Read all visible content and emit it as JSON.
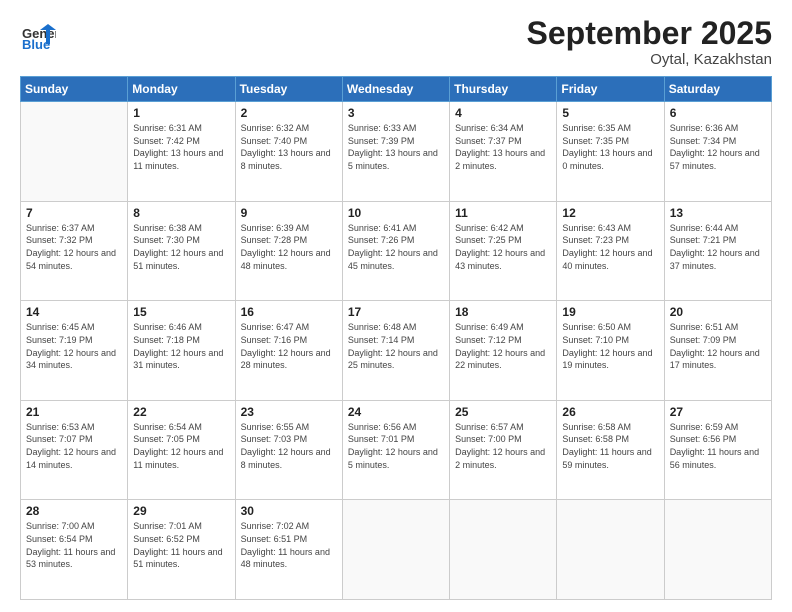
{
  "logo": {
    "text_general": "General",
    "text_blue": "Blue"
  },
  "title": "September 2025",
  "subtitle": "Oytal, Kazakhstan",
  "headers": [
    "Sunday",
    "Monday",
    "Tuesday",
    "Wednesday",
    "Thursday",
    "Friday",
    "Saturday"
  ],
  "weeks": [
    [
      {
        "day": "",
        "sunrise": "",
        "sunset": "",
        "daylight": ""
      },
      {
        "day": "1",
        "sunrise": "Sunrise: 6:31 AM",
        "sunset": "Sunset: 7:42 PM",
        "daylight": "Daylight: 13 hours and 11 minutes."
      },
      {
        "day": "2",
        "sunrise": "Sunrise: 6:32 AM",
        "sunset": "Sunset: 7:40 PM",
        "daylight": "Daylight: 13 hours and 8 minutes."
      },
      {
        "day": "3",
        "sunrise": "Sunrise: 6:33 AM",
        "sunset": "Sunset: 7:39 PM",
        "daylight": "Daylight: 13 hours and 5 minutes."
      },
      {
        "day": "4",
        "sunrise": "Sunrise: 6:34 AM",
        "sunset": "Sunset: 7:37 PM",
        "daylight": "Daylight: 13 hours and 2 minutes."
      },
      {
        "day": "5",
        "sunrise": "Sunrise: 6:35 AM",
        "sunset": "Sunset: 7:35 PM",
        "daylight": "Daylight: 13 hours and 0 minutes."
      },
      {
        "day": "6",
        "sunrise": "Sunrise: 6:36 AM",
        "sunset": "Sunset: 7:34 PM",
        "daylight": "Daylight: 12 hours and 57 minutes."
      }
    ],
    [
      {
        "day": "7",
        "sunrise": "Sunrise: 6:37 AM",
        "sunset": "Sunset: 7:32 PM",
        "daylight": "Daylight: 12 hours and 54 minutes."
      },
      {
        "day": "8",
        "sunrise": "Sunrise: 6:38 AM",
        "sunset": "Sunset: 7:30 PM",
        "daylight": "Daylight: 12 hours and 51 minutes."
      },
      {
        "day": "9",
        "sunrise": "Sunrise: 6:39 AM",
        "sunset": "Sunset: 7:28 PM",
        "daylight": "Daylight: 12 hours and 48 minutes."
      },
      {
        "day": "10",
        "sunrise": "Sunrise: 6:41 AM",
        "sunset": "Sunset: 7:26 PM",
        "daylight": "Daylight: 12 hours and 45 minutes."
      },
      {
        "day": "11",
        "sunrise": "Sunrise: 6:42 AM",
        "sunset": "Sunset: 7:25 PM",
        "daylight": "Daylight: 12 hours and 43 minutes."
      },
      {
        "day": "12",
        "sunrise": "Sunrise: 6:43 AM",
        "sunset": "Sunset: 7:23 PM",
        "daylight": "Daylight: 12 hours and 40 minutes."
      },
      {
        "day": "13",
        "sunrise": "Sunrise: 6:44 AM",
        "sunset": "Sunset: 7:21 PM",
        "daylight": "Daylight: 12 hours and 37 minutes."
      }
    ],
    [
      {
        "day": "14",
        "sunrise": "Sunrise: 6:45 AM",
        "sunset": "Sunset: 7:19 PM",
        "daylight": "Daylight: 12 hours and 34 minutes."
      },
      {
        "day": "15",
        "sunrise": "Sunrise: 6:46 AM",
        "sunset": "Sunset: 7:18 PM",
        "daylight": "Daylight: 12 hours and 31 minutes."
      },
      {
        "day": "16",
        "sunrise": "Sunrise: 6:47 AM",
        "sunset": "Sunset: 7:16 PM",
        "daylight": "Daylight: 12 hours and 28 minutes."
      },
      {
        "day": "17",
        "sunrise": "Sunrise: 6:48 AM",
        "sunset": "Sunset: 7:14 PM",
        "daylight": "Daylight: 12 hours and 25 minutes."
      },
      {
        "day": "18",
        "sunrise": "Sunrise: 6:49 AM",
        "sunset": "Sunset: 7:12 PM",
        "daylight": "Daylight: 12 hours and 22 minutes."
      },
      {
        "day": "19",
        "sunrise": "Sunrise: 6:50 AM",
        "sunset": "Sunset: 7:10 PM",
        "daylight": "Daylight: 12 hours and 19 minutes."
      },
      {
        "day": "20",
        "sunrise": "Sunrise: 6:51 AM",
        "sunset": "Sunset: 7:09 PM",
        "daylight": "Daylight: 12 hours and 17 minutes."
      }
    ],
    [
      {
        "day": "21",
        "sunrise": "Sunrise: 6:53 AM",
        "sunset": "Sunset: 7:07 PM",
        "daylight": "Daylight: 12 hours and 14 minutes."
      },
      {
        "day": "22",
        "sunrise": "Sunrise: 6:54 AM",
        "sunset": "Sunset: 7:05 PM",
        "daylight": "Daylight: 12 hours and 11 minutes."
      },
      {
        "day": "23",
        "sunrise": "Sunrise: 6:55 AM",
        "sunset": "Sunset: 7:03 PM",
        "daylight": "Daylight: 12 hours and 8 minutes."
      },
      {
        "day": "24",
        "sunrise": "Sunrise: 6:56 AM",
        "sunset": "Sunset: 7:01 PM",
        "daylight": "Daylight: 12 hours and 5 minutes."
      },
      {
        "day": "25",
        "sunrise": "Sunrise: 6:57 AM",
        "sunset": "Sunset: 7:00 PM",
        "daylight": "Daylight: 12 hours and 2 minutes."
      },
      {
        "day": "26",
        "sunrise": "Sunrise: 6:58 AM",
        "sunset": "Sunset: 6:58 PM",
        "daylight": "Daylight: 11 hours and 59 minutes."
      },
      {
        "day": "27",
        "sunrise": "Sunrise: 6:59 AM",
        "sunset": "Sunset: 6:56 PM",
        "daylight": "Daylight: 11 hours and 56 minutes."
      }
    ],
    [
      {
        "day": "28",
        "sunrise": "Sunrise: 7:00 AM",
        "sunset": "Sunset: 6:54 PM",
        "daylight": "Daylight: 11 hours and 53 minutes."
      },
      {
        "day": "29",
        "sunrise": "Sunrise: 7:01 AM",
        "sunset": "Sunset: 6:52 PM",
        "daylight": "Daylight: 11 hours and 51 minutes."
      },
      {
        "day": "30",
        "sunrise": "Sunrise: 7:02 AM",
        "sunset": "Sunset: 6:51 PM",
        "daylight": "Daylight: 11 hours and 48 minutes."
      },
      {
        "day": "",
        "sunrise": "",
        "sunset": "",
        "daylight": ""
      },
      {
        "day": "",
        "sunrise": "",
        "sunset": "",
        "daylight": ""
      },
      {
        "day": "",
        "sunrise": "",
        "sunset": "",
        "daylight": ""
      },
      {
        "day": "",
        "sunrise": "",
        "sunset": "",
        "daylight": ""
      }
    ]
  ]
}
